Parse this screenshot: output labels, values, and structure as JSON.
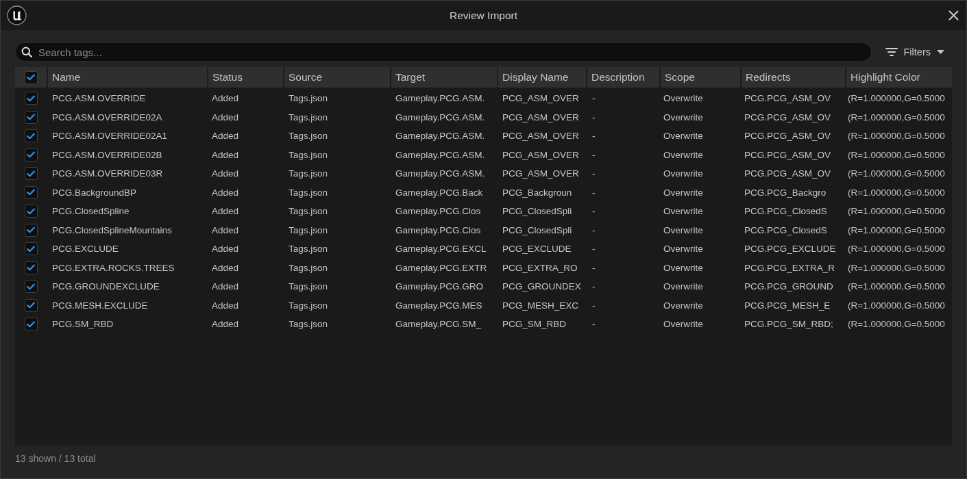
{
  "window": {
    "title": "Review Import"
  },
  "search": {
    "placeholder": "Search tags..."
  },
  "filters_button": {
    "label": "Filters"
  },
  "table": {
    "select_all": {
      "checked": true
    },
    "columns": [
      "Name",
      "Status",
      "Source",
      "Target",
      "Display Name",
      "Description",
      "Scope",
      "Redirects",
      "Highlight Color"
    ],
    "rows": [
      {
        "checked": true,
        "cells": [
          "PCG.ASM.OVERRIDE",
          "Added",
          "Tags.json",
          "Gameplay.PCG.ASM.",
          "PCG_ASM_OVER",
          "-",
          "Overwrite",
          "PCG.PCG_ASM_OV",
          "(R=1.000000,G=0.5000"
        ]
      },
      {
        "checked": true,
        "cells": [
          "PCG.ASM.OVERRIDE02A",
          "Added",
          "Tags.json",
          "Gameplay.PCG.ASM.",
          "PCG_ASM_OVER",
          "-",
          "Overwrite",
          "PCG.PCG_ASM_OV",
          "(R=1.000000,G=0.5000"
        ]
      },
      {
        "checked": true,
        "cells": [
          "PCG.ASM.OVERRIDE02A1",
          "Added",
          "Tags.json",
          "Gameplay.PCG.ASM.",
          "PCG_ASM_OVER",
          "-",
          "Overwrite",
          "PCG.PCG_ASM_OV",
          "(R=1.000000,G=0.5000"
        ]
      },
      {
        "checked": true,
        "cells": [
          "PCG.ASM.OVERRIDE02B",
          "Added",
          "Tags.json",
          "Gameplay.PCG.ASM.",
          "PCG_ASM_OVER",
          "-",
          "Overwrite",
          "PCG.PCG_ASM_OV",
          "(R=1.000000,G=0.5000"
        ]
      },
      {
        "checked": true,
        "cells": [
          "PCG.ASM.OVERRIDE03R",
          "Added",
          "Tags.json",
          "Gameplay.PCG.ASM.",
          "PCG_ASM_OVER",
          "-",
          "Overwrite",
          "PCG.PCG_ASM_OV",
          "(R=1.000000,G=0.5000"
        ]
      },
      {
        "checked": true,
        "cells": [
          "PCG.BackgroundBP",
          "Added",
          "Tags.json",
          "Gameplay.PCG.Back",
          "PCG_Backgroun",
          "-",
          "Overwrite",
          "PCG.PCG_Backgro",
          "(R=1.000000,G=0.5000"
        ]
      },
      {
        "checked": true,
        "cells": [
          "PCG.ClosedSpline",
          "Added",
          "Tags.json",
          "Gameplay.PCG.Clos",
          "PCG_ClosedSpli",
          "-",
          "Overwrite",
          "PCG.PCG_ClosedS",
          "(R=1.000000,G=0.5000"
        ]
      },
      {
        "checked": true,
        "cells": [
          "PCG.ClosedSplineMountains",
          "Added",
          "Tags.json",
          "Gameplay.PCG.Clos",
          "PCG_ClosedSpli",
          "-",
          "Overwrite",
          "PCG.PCG_ClosedS",
          "(R=1.000000,G=0.5000"
        ]
      },
      {
        "checked": true,
        "cells": [
          "PCG.EXCLUDE",
          "Added",
          "Tags.json",
          "Gameplay.PCG.EXCL",
          "PCG_EXCLUDE",
          "-",
          "Overwrite",
          "PCG.PCG_EXCLUDE",
          "(R=1.000000,G=0.5000"
        ]
      },
      {
        "checked": true,
        "cells": [
          "PCG.EXTRA.ROCKS.TREES",
          "Added",
          "Tags.json",
          "Gameplay.PCG.EXTR",
          "PCG_EXTRA_RO",
          "-",
          "Overwrite",
          "PCG.PCG_EXTRA_R",
          "(R=1.000000,G=0.5000"
        ]
      },
      {
        "checked": true,
        "cells": [
          "PCG.GROUNDEXCLUDE",
          "Added",
          "Tags.json",
          "Gameplay.PCG.GRO",
          "PCG_GROUNDEX",
          "-",
          "Overwrite",
          "PCG.PCG_GROUND",
          "(R=1.000000,G=0.5000"
        ]
      },
      {
        "checked": true,
        "cells": [
          "PCG.MESH.EXCLUDE",
          "Added",
          "Tags.json",
          "Gameplay.PCG.MES",
          "PCG_MESH_EXC",
          "-",
          "Overwrite",
          "PCG.PCG_MESH_E",
          "(R=1.000000,G=0.5000"
        ]
      },
      {
        "checked": true,
        "cells": [
          "PCG.SM_RBD",
          "Added",
          "Tags.json",
          "Gameplay.PCG.SM_",
          "PCG_SM_RBD",
          "-",
          "Overwrite",
          "PCG.PCG_SM_RBD;",
          "(R=1.000000,G=0.5000"
        ]
      }
    ]
  },
  "status_bar": {
    "text": "13 shown / 13 total"
  }
}
